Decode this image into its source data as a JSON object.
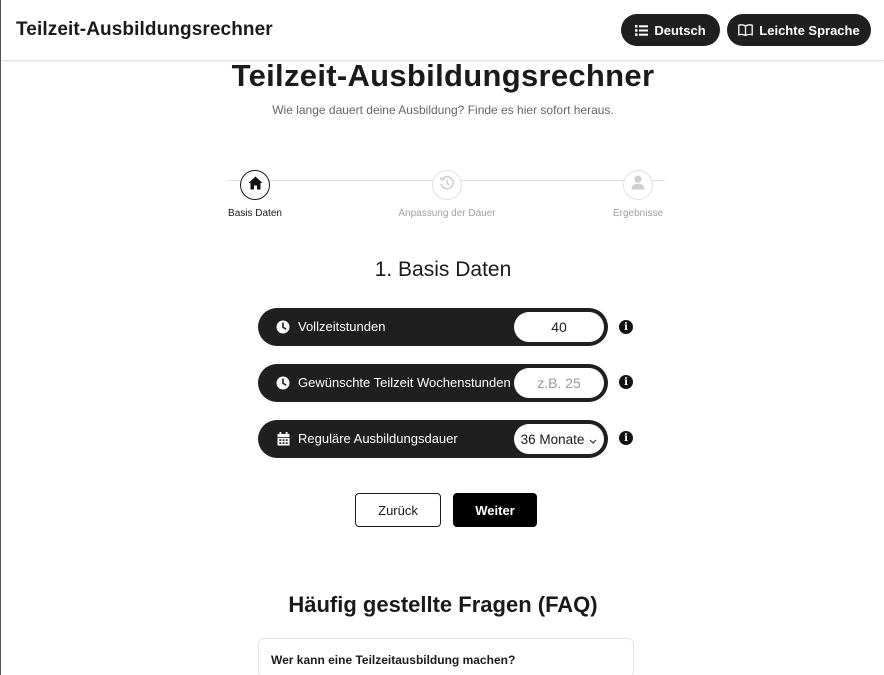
{
  "header": {
    "brand": "Teilzeit-Ausbildungsrechner",
    "language_button": "Deutsch",
    "easy_language_button": "Leichte Sprache"
  },
  "hero": {
    "title": "Teilzeit-Ausbildungsrechner",
    "subtitle": "Wie lange dauert deine Ausbildung? Finde es hier sofort heraus."
  },
  "stepper": {
    "steps": [
      {
        "label": "Basis Daten",
        "icon": "home-icon",
        "state": "active"
      },
      {
        "label": "Anpassung der Dauer",
        "icon": "history-icon",
        "state": "inactive"
      },
      {
        "label": "Ergebnisse",
        "icon": "user-icon",
        "state": "inactive"
      }
    ]
  },
  "form": {
    "section_title": "1. Basis Daten",
    "fields": [
      {
        "label": "Vollzeitstunden",
        "icon": "clock-icon",
        "value": "40",
        "placeholder": ""
      },
      {
        "label": "Gewünschte Teilzeit Wochenstunden",
        "icon": "clock-icon",
        "value": "",
        "placeholder": "z.B. 25"
      },
      {
        "label": "Reguläre Ausbildungsdauer",
        "icon": "calendar-icon",
        "selected": "36 Monate"
      }
    ]
  },
  "actions": {
    "back": "Zurück",
    "next": "Weiter"
  },
  "faq": {
    "title": "Häufig gestellte Fragen (FAQ)",
    "items": [
      {
        "question": "Wer kann eine Teilzeitausbildung machen?"
      }
    ]
  },
  "colors": {
    "dark": "#1f1f1f",
    "muted": "#a0a0a0",
    "border": "#e0e0e0"
  }
}
